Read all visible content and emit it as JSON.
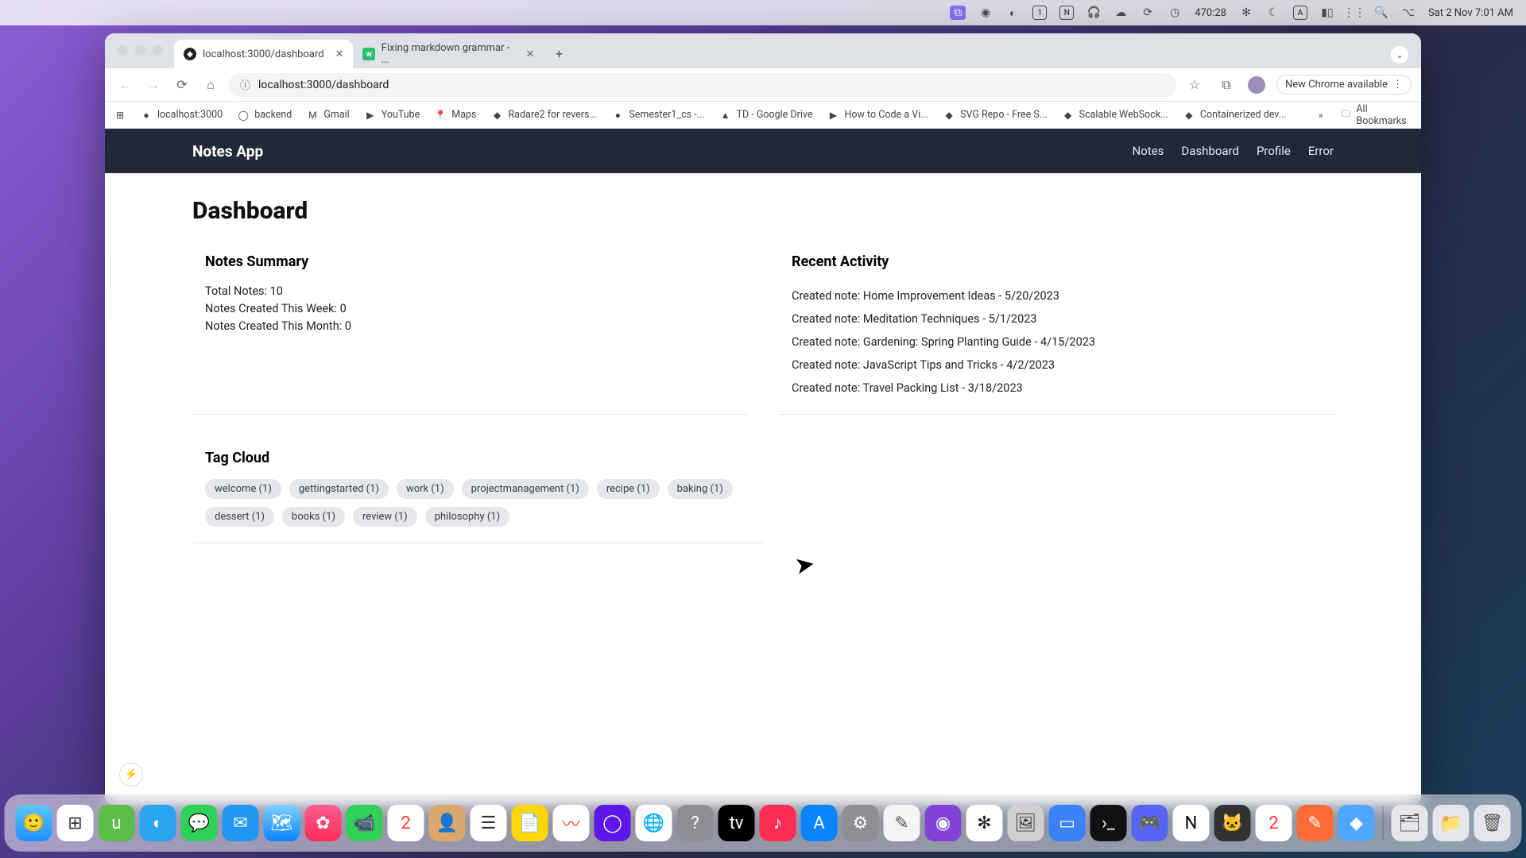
{
  "menubar": {
    "time": "Sat 2 Nov  7:01 AM",
    "counter": "470:28"
  },
  "browser": {
    "tabs": [
      {
        "title": "localhost:3000/dashboard",
        "active": true
      },
      {
        "title": "Fixing markdown grammar - ...",
        "active": false
      }
    ],
    "url": "localhost:3000/dashboard",
    "update_badge": "New Chrome available",
    "bookmarks": [
      "localhost:3000",
      "backend",
      "Gmail",
      "YouTube",
      "Maps",
      "Radare2 for revers...",
      "Semester1_cs -...",
      "TD - Google Drive",
      "How to Code a Vi...",
      "SVG Repo - Free S...",
      "Scalable WebSock...",
      "Containerized dev..."
    ],
    "all_bookmarks": "All Bookmarks"
  },
  "app": {
    "brand": "Notes App",
    "nav": [
      "Notes",
      "Dashboard",
      "Profile",
      "Error"
    ],
    "page_title": "Dashboard",
    "summary": {
      "title": "Notes Summary",
      "lines": {
        "total": "Total Notes: 10",
        "week": "Notes Created This Week: 0",
        "month": "Notes Created This Month: 0"
      }
    },
    "recent": {
      "title": "Recent Activity",
      "items": [
        "Created note: Home Improvement Ideas - 5/20/2023",
        "Created note: Meditation Techniques - 5/1/2023",
        "Created note: Gardening: Spring Planting Guide - 4/15/2023",
        "Created note: JavaScript Tips and Tricks - 4/2/2023",
        "Created note: Travel Packing List - 3/18/2023"
      ]
    },
    "tagcloud": {
      "title": "Tag Cloud",
      "tags": [
        "welcome (1)",
        "gettingstarted (1)",
        "work (1)",
        "projectmanagement (1)",
        "recipe (1)",
        "baking (1)",
        "dessert (1)",
        "books (1)",
        "review (1)",
        "philosophy (1)"
      ]
    }
  }
}
